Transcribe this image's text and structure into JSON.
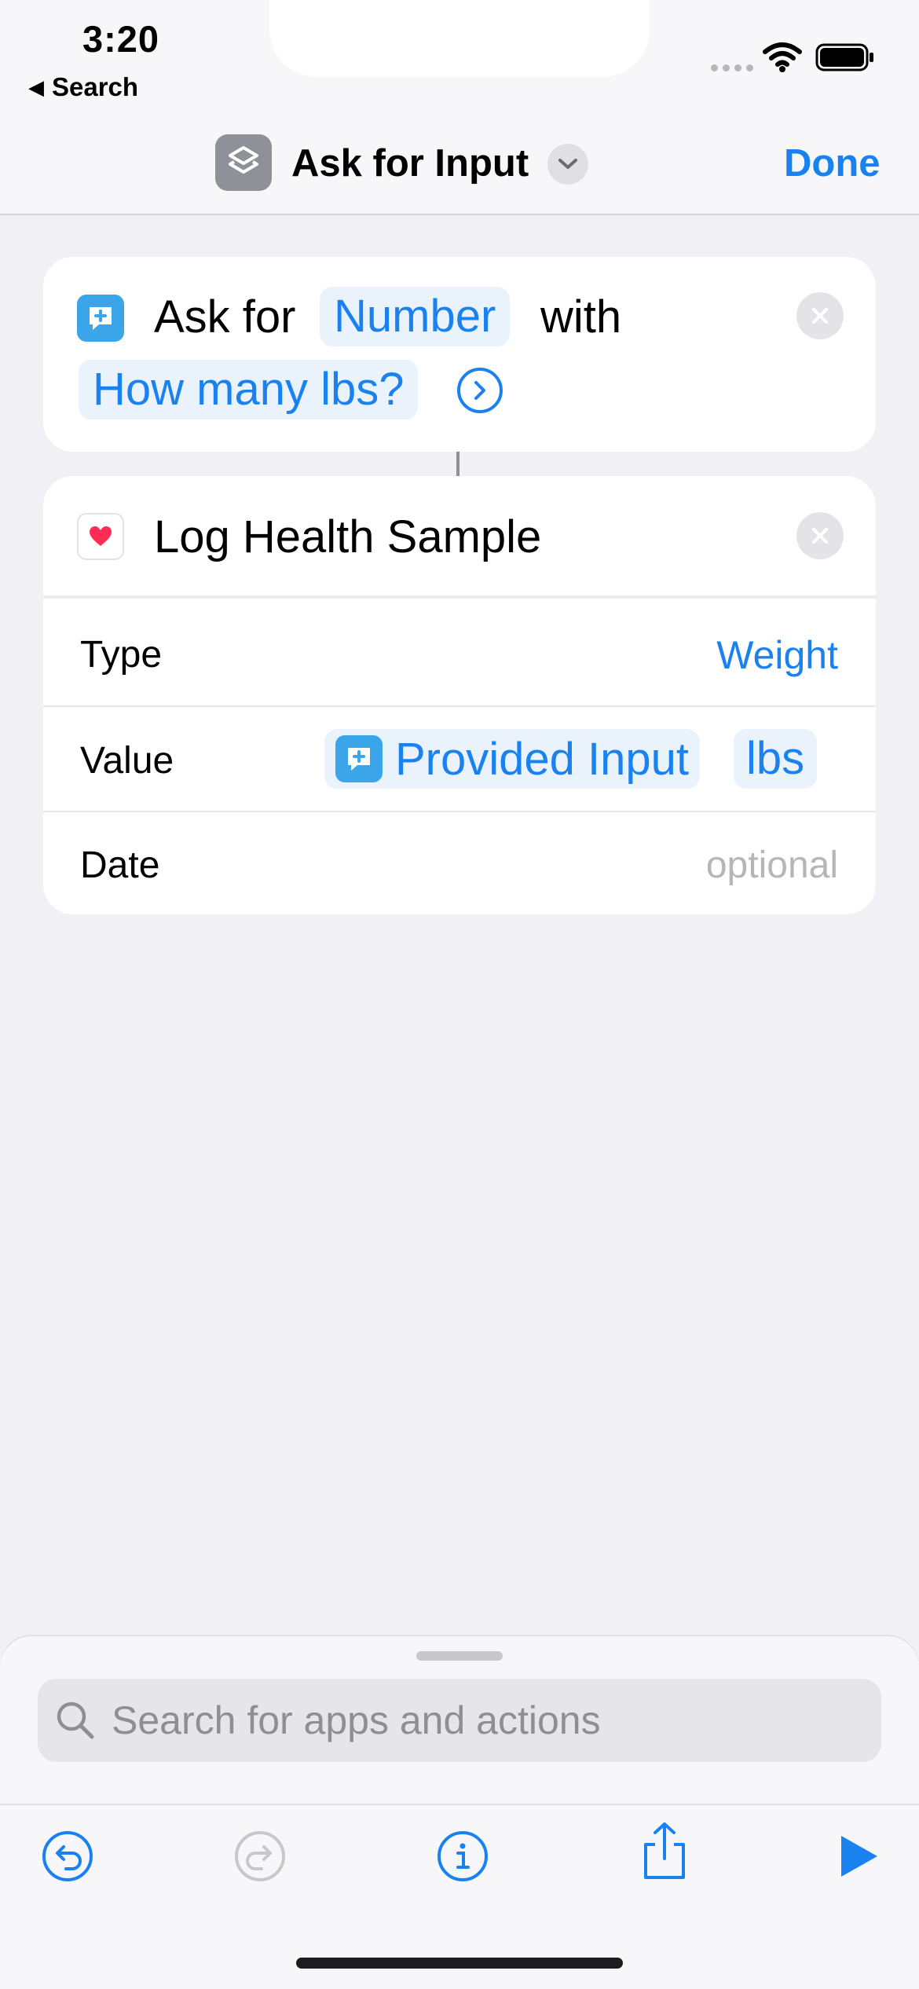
{
  "status_bar": {
    "time": "3:20",
    "back_label": "Search",
    "icons": [
      "cellular-dots-icon",
      "wifi-icon",
      "battery-icon"
    ]
  },
  "nav": {
    "app_icon": "shortcuts-layers-icon",
    "title": "Ask for Input",
    "menu_icon": "chevron-down-icon",
    "done_label": "Done"
  },
  "action_ask": {
    "icon": "message-plus-icon",
    "prefix": "Ask for",
    "type_value": "Number",
    "connector": "with",
    "prompt_value": "How many lbs?",
    "expand_icon": "chevron-right-circle-icon",
    "remove_icon": "close-icon"
  },
  "action_log": {
    "icon": "heart-icon",
    "title": "Log Health Sample",
    "remove_icon": "close-icon",
    "rows": {
      "type": {
        "label": "Type",
        "value": "Weight"
      },
      "value": {
        "label": "Value",
        "variable": "Provided Input",
        "unit": "lbs"
      },
      "date": {
        "label": "Date",
        "placeholder": "optional"
      }
    }
  },
  "search": {
    "placeholder": "Search for apps and actions"
  },
  "toolbar": {
    "buttons": [
      "undo-icon",
      "redo-icon",
      "info-icon",
      "share-icon",
      "play-icon"
    ]
  },
  "colors": {
    "accent": "#1a82f0",
    "background": "#f1f1f5",
    "card": "#ffffff",
    "message_icon": "#3aa6e9",
    "heart": "#ff2d55",
    "app_icon": "#8e9197"
  }
}
